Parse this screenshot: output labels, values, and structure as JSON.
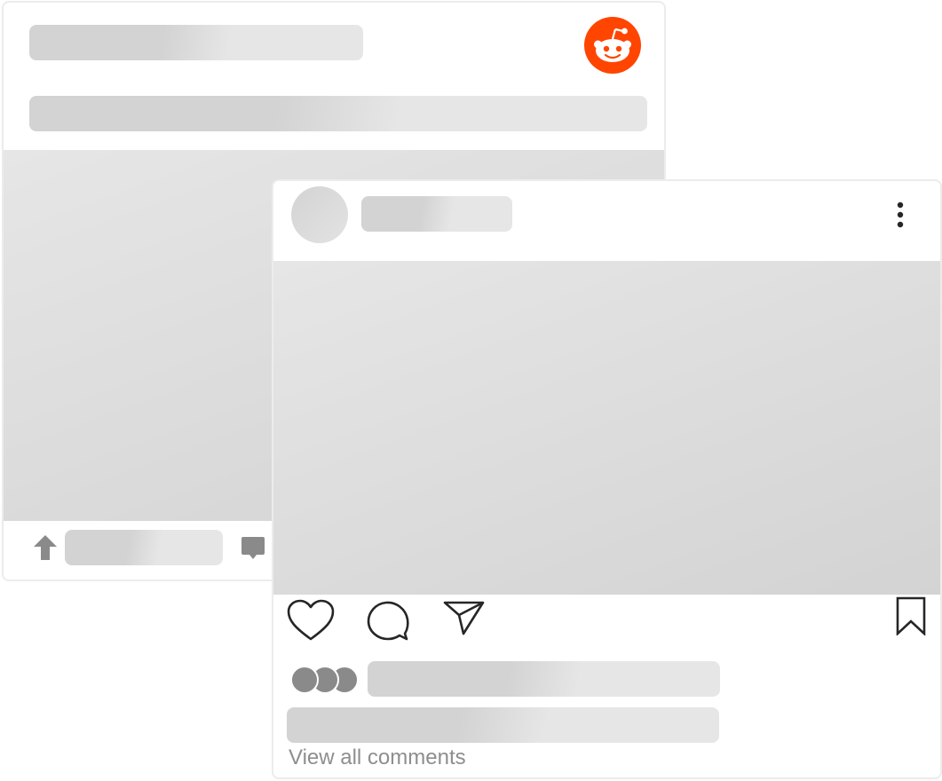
{
  "reddit_card": {
    "logo_icon": "reddit-logo-icon",
    "brand_color": "#FF4500",
    "upvote_icon": "upvote-arrow-icon",
    "comment_icon": "comment-bubble-icon"
  },
  "instagram_card": {
    "more_icon": "vertical-dots-icon",
    "like_icon": "heart-icon",
    "comment_icon": "comment-icon",
    "share_icon": "paper-plane-icon",
    "save_icon": "bookmark-icon",
    "view_all_comments": "View all comments"
  },
  "colors": {
    "skeleton_dark": "#d3d3d3",
    "skeleton_light": "#e6e6e6",
    "icon_gray": "#8a8a8a",
    "icon_dark": "#262626",
    "muted_text": "#8e8e8e"
  }
}
